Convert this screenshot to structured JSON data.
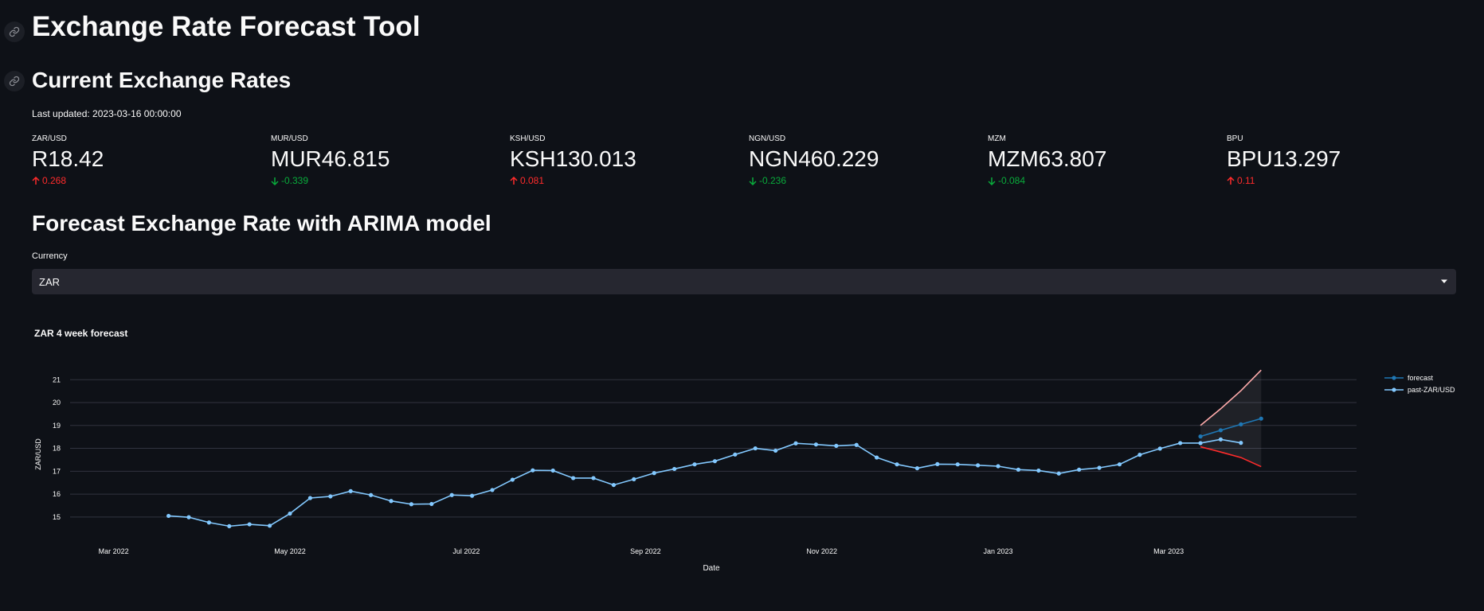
{
  "title": "Exchange Rate Forecast Tool",
  "current": {
    "heading": "Current Exchange Rates",
    "last_updated": "Last updated: 2023-03-16 00:00:00",
    "metrics": [
      {
        "label": "ZAR/USD",
        "value": "R18.42",
        "delta": "0.268",
        "direction": "up"
      },
      {
        "label": "MUR/USD",
        "value": "MUR46.815",
        "delta": "-0.339",
        "direction": "down"
      },
      {
        "label": "KSH/USD",
        "value": "KSH130.013",
        "delta": "0.081",
        "direction": "up"
      },
      {
        "label": "NGN/USD",
        "value": "NGN460.229",
        "delta": "-0.236",
        "direction": "down"
      },
      {
        "label": "MZM",
        "value": "MZM63.807",
        "delta": "-0.084",
        "direction": "down"
      },
      {
        "label": "BPU",
        "value": "BPU13.297",
        "delta": "0.11",
        "direction": "up"
      }
    ]
  },
  "forecast": {
    "heading": "Forecast Exchange Rate with ARIMA model",
    "currency_label": "Currency",
    "currency_value": "ZAR"
  },
  "colors": {
    "up": "#ff2b2b",
    "down": "#09ab3b",
    "past": "#83c9ff",
    "forecast": "#1f77b4",
    "upper": "#ffabab",
    "lower": "#ff2b2b",
    "actual_overlap": "#83c9ff"
  },
  "chart_data": {
    "type": "line",
    "title": "ZAR 4 week forecast",
    "xlabel": "Date",
    "ylabel": "ZAR/USD",
    "x_ticks": [
      "Mar 2022",
      "May 2022",
      "Jul 2022",
      "Sep 2022",
      "Nov 2022",
      "Jan 2023",
      "Mar 2023"
    ],
    "x_tick_dates": [
      "2022-03-01",
      "2022-05-01",
      "2022-07-01",
      "2022-09-01",
      "2022-11-01",
      "2023-01-01",
      "2023-03-01"
    ],
    "y_ticks": [
      15,
      16,
      17,
      18,
      19,
      20,
      21
    ],
    "xlim": [
      "2022-02-20",
      "2023-05-05"
    ],
    "ylim": [
      14.3,
      21.6
    ],
    "grid": true,
    "legend_position": "top-right",
    "series": [
      {
        "name": "past-ZAR/USD",
        "dates": [
          "2022-03-20",
          "2022-03-27",
          "2022-04-03",
          "2022-04-10",
          "2022-04-17",
          "2022-04-24",
          "2022-05-01",
          "2022-05-08",
          "2022-05-15",
          "2022-05-22",
          "2022-05-29",
          "2022-06-05",
          "2022-06-12",
          "2022-06-19",
          "2022-06-26",
          "2022-07-03",
          "2022-07-10",
          "2022-07-17",
          "2022-07-24",
          "2022-07-31",
          "2022-08-07",
          "2022-08-14",
          "2022-08-21",
          "2022-08-28",
          "2022-09-04",
          "2022-09-11",
          "2022-09-18",
          "2022-09-25",
          "2022-10-02",
          "2022-10-09",
          "2022-10-16",
          "2022-10-23",
          "2022-10-30",
          "2022-11-06",
          "2022-11-13",
          "2022-11-20",
          "2022-11-27",
          "2022-12-04",
          "2022-12-11",
          "2022-12-18",
          "2022-12-25",
          "2023-01-01",
          "2023-01-08",
          "2023-01-15",
          "2023-01-22",
          "2023-01-29",
          "2023-02-05",
          "2023-02-12",
          "2023-02-19",
          "2023-02-26",
          "2023-03-05",
          "2023-03-12",
          "2023-03-19",
          "2023-03-26"
        ],
        "values": [
          15.05,
          14.99,
          14.76,
          14.6,
          14.68,
          14.62,
          15.15,
          15.83,
          15.9,
          16.13,
          15.96,
          15.7,
          15.56,
          15.57,
          15.96,
          15.93,
          16.18,
          16.63,
          17.04,
          17.03,
          16.7,
          16.7,
          16.4,
          16.65,
          16.92,
          17.1,
          17.3,
          17.44,
          17.73,
          18.0,
          17.9,
          18.22,
          18.17,
          18.11,
          18.15,
          17.6,
          17.3,
          17.13,
          17.31,
          17.3,
          17.26,
          17.22,
          17.07,
          17.03,
          16.9,
          17.07,
          17.15,
          17.3,
          17.72,
          17.99,
          18.23,
          18.23,
          18.39,
          18.24
        ]
      },
      {
        "name": "forecast",
        "dates": [
          "2023-03-12",
          "2023-03-19",
          "2023-03-26",
          "2023-04-02"
        ],
        "values": [
          18.52,
          18.79,
          19.05,
          19.3
        ]
      }
    ],
    "confidence_band": {
      "dates": [
        "2023-03-12",
        "2023-03-19",
        "2023-03-26",
        "2023-04-02"
      ],
      "upper": [
        19.0,
        19.73,
        20.52,
        21.42
      ],
      "lower": [
        18.07,
        17.84,
        17.6,
        17.2
      ]
    }
  }
}
